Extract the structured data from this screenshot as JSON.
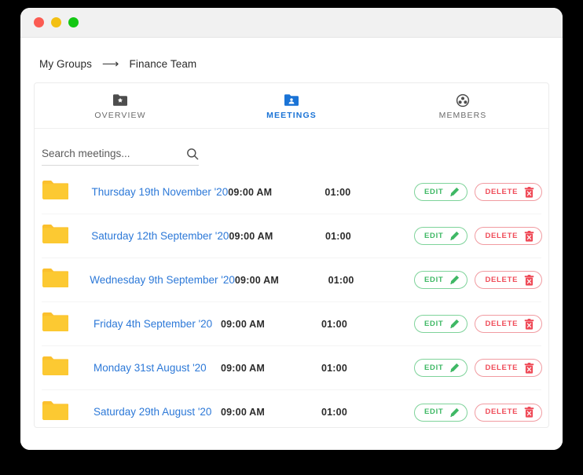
{
  "window": {
    "traffic_lights": [
      "close",
      "minimize",
      "zoom"
    ],
    "colors": {
      "close": "#fb5b52",
      "minimize": "#f3c013",
      "zoom": "#13c713",
      "accent_blue": "#2d79d8",
      "tab_active": "#1a73d6",
      "folder_yellow": "#fbc02d",
      "edit_green": "#3fb865",
      "delete_red": "#ef4b58"
    }
  },
  "breadcrumb": {
    "root": "My Groups",
    "separator": "⟶",
    "current": "Finance Team"
  },
  "tabs": [
    {
      "label": "OVERVIEW",
      "icon": "folder-star-icon",
      "active": false
    },
    {
      "label": "MEETINGS",
      "icon": "folder-person-icon",
      "active": true
    },
    {
      "label": "MEMBERS",
      "icon": "members-group-icon",
      "active": false
    }
  ],
  "search": {
    "placeholder": "Search meetings...",
    "value": "",
    "icon": "search-icon"
  },
  "meetings": {
    "row_icon": "folder-icon",
    "actions": {
      "edit_label": "EDIT",
      "edit_icon": "pencil-icon",
      "delete_label": "DELETE",
      "delete_icon": "trash-icon"
    },
    "rows": [
      {
        "title": "Thursday 19th November '20",
        "time": "09:00 AM",
        "duration": "01:00"
      },
      {
        "title": "Saturday 12th September '20",
        "time": "09:00 AM",
        "duration": "01:00"
      },
      {
        "title": "Wednesday 9th September '20",
        "time": "09:00 AM",
        "duration": "01:00"
      },
      {
        "title": "Friday 4th September '20",
        "time": "09:00 AM",
        "duration": "01:00"
      },
      {
        "title": "Monday 31st August '20",
        "time": "09:00 AM",
        "duration": "01:00"
      },
      {
        "title": "Saturday 29th August '20",
        "time": "09:00 AM",
        "duration": "01:00"
      }
    ]
  }
}
